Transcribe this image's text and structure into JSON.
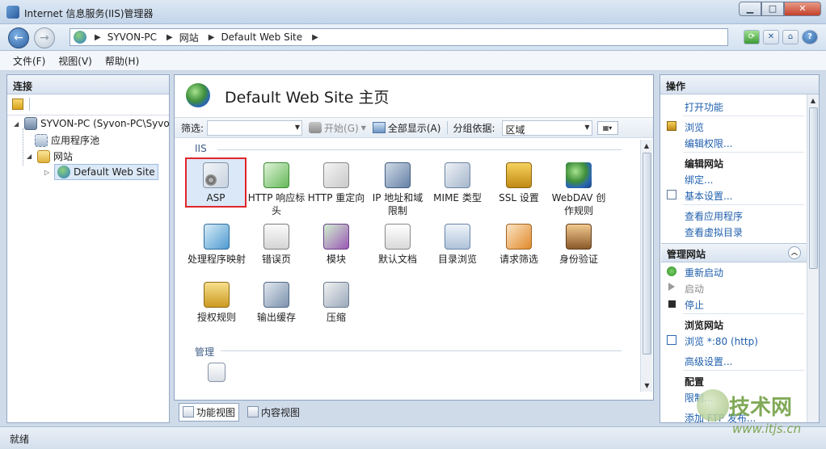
{
  "window": {
    "title": "Internet 信息服务(IIS)管理器",
    "buttons": {
      "minimize": "▁",
      "maximize": "□",
      "close": "✕"
    }
  },
  "nav": {
    "back": "←",
    "forward": "→",
    "breadcrumb": [
      "SYVON-PC",
      "网站",
      "Default Web Site"
    ],
    "separator": "▶",
    "tools": {
      "refresh": "⟳",
      "stop": "✕",
      "home": "⌂",
      "help": "?"
    }
  },
  "menu": {
    "file": "文件(F)",
    "view": "视图(V)",
    "help": "帮助(H)"
  },
  "connections": {
    "title": "连接",
    "tree": {
      "server": "SYVON-PC (Syvon-PC\\Syvo",
      "app_pools": "应用程序池",
      "sites": "网站",
      "default_site": "Default Web Site"
    }
  },
  "center": {
    "title": "Default Web Site 主页",
    "filter": {
      "label": "筛选:",
      "start": "开始(G)",
      "show_all": "全部显示(A)",
      "group_by_label": "分组依据:",
      "group_by_value": "区域"
    },
    "sections": {
      "iis": "IIS",
      "management": "管理"
    },
    "features": [
      {
        "label": "ASP"
      },
      {
        "label": "HTTP 响应标头"
      },
      {
        "label": "HTTP 重定向"
      },
      {
        "label": "IP 地址和域限制"
      },
      {
        "label": "MIME 类型"
      },
      {
        "label": "SSL 设置"
      },
      {
        "label": "WebDAV 创作规则"
      },
      {
        "label": "处理程序映射"
      },
      {
        "label": "错误页"
      },
      {
        "label": "模块"
      },
      {
        "label": "默认文档"
      },
      {
        "label": "目录浏览"
      },
      {
        "label": "请求筛选"
      },
      {
        "label": "身份验证"
      },
      {
        "label": "授权规则"
      },
      {
        "label": "输出缓存"
      },
      {
        "label": "压缩"
      }
    ],
    "tabs": {
      "features_view": "功能视图",
      "content_view": "内容视图"
    }
  },
  "actions": {
    "title": "操作",
    "open_feature": "打开功能",
    "explore": "浏览",
    "edit_permissions": "编辑权限...",
    "edit_site_header": "编辑网站",
    "bindings": "绑定...",
    "basic_settings": "基本设置...",
    "view_applications": "查看应用程序",
    "view_virtual_dirs": "查看虚拟目录",
    "manage_site_header": "管理网站",
    "restart": "重新启动",
    "start": "启动",
    "stop": "停止",
    "browse_site_header": "浏览网站",
    "browse_80": "浏览 *:80 (http)",
    "advanced_settings": "高级设置...",
    "config_header": "配置",
    "limits": "限制...",
    "add_ftp": "添加 FTP 发布..."
  },
  "status": {
    "text": "就绪"
  },
  "watermark": {
    "brand": "技术网",
    "url": "www.itjs.cn"
  }
}
